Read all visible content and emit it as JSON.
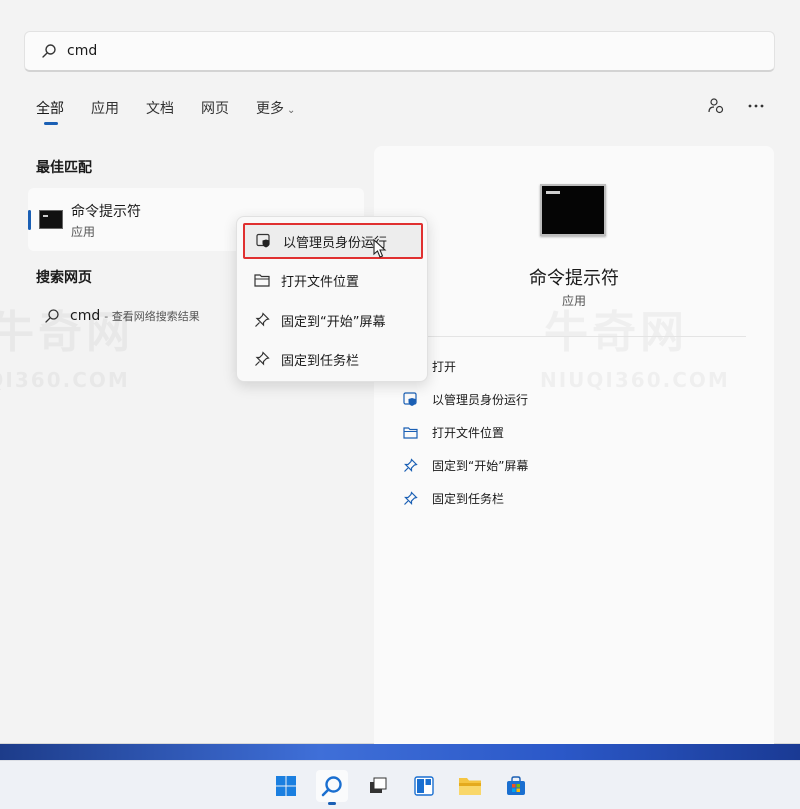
{
  "search": {
    "query": "cmd"
  },
  "tabs": [
    {
      "label": "全部"
    },
    {
      "label": "应用"
    },
    {
      "label": "文档"
    },
    {
      "label": "网页"
    },
    {
      "label": "更多"
    }
  ],
  "best_match": {
    "section_title": "最佳匹配",
    "name": "命令提示符",
    "type": "应用"
  },
  "web_search": {
    "section_title": "搜索网页",
    "query": "cmd",
    "suffix": "- 查看网络搜索结果"
  },
  "context_menu": {
    "items": [
      {
        "label": "以管理员身份运行",
        "icon": "shield-icon",
        "highlighted": true
      },
      {
        "label": "打开文件位置",
        "icon": "folder-icon"
      },
      {
        "label": "固定到“开始”屏幕",
        "icon": "pin-icon"
      },
      {
        "label": "固定到任务栏",
        "icon": "pin-icon"
      }
    ]
  },
  "detail": {
    "name": "命令提示符",
    "type": "应用",
    "actions": [
      {
        "label": "打开",
        "icon": "open-icon"
      },
      {
        "label": "以管理员身份运行",
        "icon": "shield-icon"
      },
      {
        "label": "打开文件位置",
        "icon": "folder-icon"
      },
      {
        "label": "固定到“开始”屏幕",
        "icon": "pin-icon"
      },
      {
        "label": "固定到任务栏",
        "icon": "pin-icon"
      }
    ]
  },
  "watermark": {
    "text": "牛奇网",
    "domain": "NIUQI360.COM"
  },
  "taskbar": {
    "icons": [
      "windows-start-icon",
      "search-icon",
      "task-view-icon",
      "widgets-icon",
      "file-explorer-icon",
      "microsoft-store-icon"
    ]
  },
  "colors": {
    "accent": "#1a5fb4",
    "highlight_border": "#e03030"
  }
}
